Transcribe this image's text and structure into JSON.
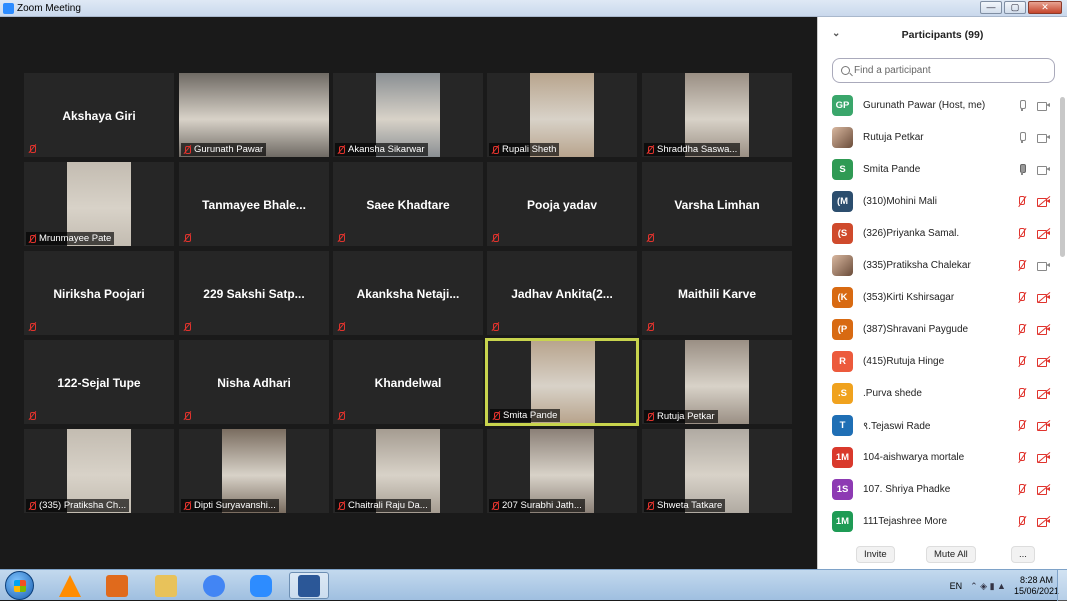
{
  "window": {
    "title": "Zoom Meeting",
    "minimize": "—",
    "maximize": "▢",
    "close": "✕"
  },
  "tiles": [
    {
      "name": "Akshaya Giri",
      "video": false
    },
    {
      "name": "Gurunath Pawar",
      "video": true
    },
    {
      "name": "Akansha Sikarwar",
      "video": true
    },
    {
      "name": "Rupali Sheth",
      "video": true
    },
    {
      "name": "Shraddha Saswa...",
      "video": true
    },
    {
      "name": "Mrunmayee Pate",
      "video": true
    },
    {
      "name": "Tanmayee  Bhale...",
      "video": false
    },
    {
      "name": "Saee Khadtare",
      "video": false
    },
    {
      "name": "Pooja  yadav",
      "video": false
    },
    {
      "name": "Varsha Limhan",
      "video": false
    },
    {
      "name": "Niriksha Poojari",
      "video": false
    },
    {
      "name": "229  Sakshi  Satp...",
      "video": false
    },
    {
      "name": "Akanksha  Netaji...",
      "video": false
    },
    {
      "name": "Jadhav  Ankita(2...",
      "video": false
    },
    {
      "name": "Maithili Karve",
      "video": false
    },
    {
      "name": "122-Sejal Tupe",
      "video": false
    },
    {
      "name": "Nisha Adhari",
      "video": false
    },
    {
      "name": "Khandelwal",
      "video": false
    },
    {
      "name": "Smita Pande",
      "video": true,
      "active": true
    },
    {
      "name": "Rutuja Petkar",
      "video": true
    },
    {
      "name": "(335) Pratiksha Ch...",
      "video": true
    },
    {
      "name": "Dipti Suryavanshi...",
      "video": true
    },
    {
      "name": "Chaitrali Raju Da...",
      "video": true
    },
    {
      "name": "207 Surabhi Jath...",
      "video": true
    },
    {
      "name": "Shweta Tatkare",
      "video": true
    }
  ],
  "panel": {
    "title": "Participants (99)",
    "search_placeholder": "Find a participant",
    "participants": [
      {
        "initials": "GP",
        "name": "Gurunath Pawar (Host, me)",
        "color": "#3aa66b",
        "mic": "on",
        "cam": "on"
      },
      {
        "initials": "",
        "name": "Rutuja Petkar",
        "color": "#c9a28a",
        "mic": "on",
        "cam": "on",
        "photo": true
      },
      {
        "initials": "S",
        "name": "Smita Pande",
        "color": "#2f9a54",
        "mic": "on-dark",
        "cam": "on"
      },
      {
        "initials": "(M",
        "name": "(310)Mohini Mali",
        "color": "#2c4e6e",
        "mic": "off",
        "cam": "off"
      },
      {
        "initials": "(S",
        "name": "(326)Priyanka Samal.",
        "color": "#cf4a2c",
        "mic": "off",
        "cam": "off"
      },
      {
        "initials": "",
        "name": "(335)Pratiksha Chalekar",
        "color": "#b98b59",
        "mic": "off",
        "cam": "on",
        "photo": true
      },
      {
        "initials": "(K",
        "name": "(353)Kirti Kshirsagar",
        "color": "#d86a12",
        "mic": "off",
        "cam": "off"
      },
      {
        "initials": "(P",
        "name": "(387)Shravani Paygude",
        "color": "#d86a12",
        "mic": "off",
        "cam": "off"
      },
      {
        "initials": "R",
        "name": "(415)Rutuja Hinge",
        "color": "#ec5a3c",
        "mic": "off",
        "cam": "off"
      },
      {
        "initials": ".S",
        "name": ".Purva shede",
        "color": "#f0a21e",
        "mic": "off",
        "cam": "off"
      },
      {
        "initials": "T",
        "name": "९.Tejaswi Rade",
        "color": "#1f6fb5",
        "mic": "off",
        "cam": "off"
      },
      {
        "initials": "1M",
        "name": "104-aishwarya mortale",
        "color": "#d9392c",
        "mic": "off",
        "cam": "off"
      },
      {
        "initials": "1S",
        "name": "107. Shriya Phadke",
        "color": "#8d3ab3",
        "mic": "off",
        "cam": "off"
      },
      {
        "initials": "1M",
        "name": "111Tejashree More",
        "color": "#1e9b55",
        "mic": "off",
        "cam": "off"
      }
    ],
    "invite": "Invite",
    "mute_all": "Mute All",
    "more": "..."
  },
  "taskbar": {
    "apps": [
      {
        "icon": "vlc-icon",
        "color": "#ff8c00"
      },
      {
        "icon": "media-player-icon",
        "color": "#e06a1c"
      },
      {
        "icon": "file-explorer-icon",
        "color": "#e8c25a"
      },
      {
        "icon": "chrome-icon",
        "color": "#4285f4"
      },
      {
        "icon": "zoom-icon",
        "color": "#2d8cff"
      },
      {
        "icon": "word-icon",
        "color": "#2b5797",
        "active": true
      }
    ],
    "language": "EN",
    "time": "8:28 AM",
    "date": "15/06/2021"
  }
}
